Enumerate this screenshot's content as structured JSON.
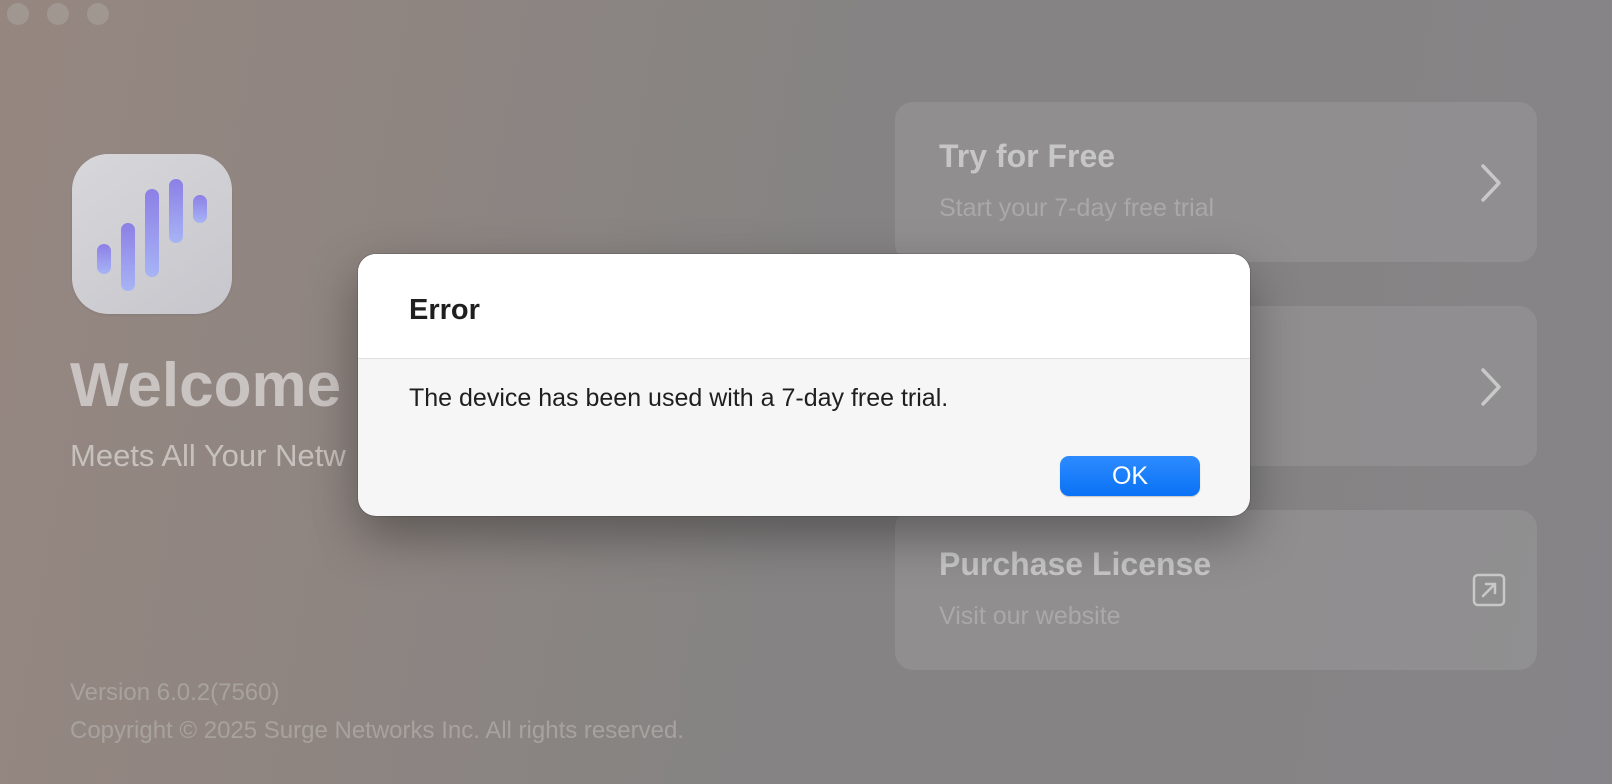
{
  "window": {
    "traffic_lights": [
      "close-button",
      "minimize-button",
      "zoom-button"
    ]
  },
  "welcome": {
    "title": "Welcome t",
    "subtitle": "Meets All Your Netw",
    "version": "Version 6.0.2(7560)",
    "copyright": "Copyright © 2025 Surge Networks Inc. All rights reserved."
  },
  "cards": [
    {
      "title": "Try for Free",
      "subtitle": "Start your 7-day free trial",
      "icon": "chevron-right-icon"
    },
    {
      "title": "",
      "subtitle": "",
      "icon": "chevron-right-icon"
    },
    {
      "title": "Purchase License",
      "subtitle": "Visit our website",
      "icon": "external-link-icon"
    }
  ],
  "dialog": {
    "title": "Error",
    "message": "The device has been used with a 7-day free trial.",
    "ok_label": "OK"
  },
  "colors": {
    "accent": "#0a72f5",
    "icon_bars": "#8f8ef0"
  }
}
